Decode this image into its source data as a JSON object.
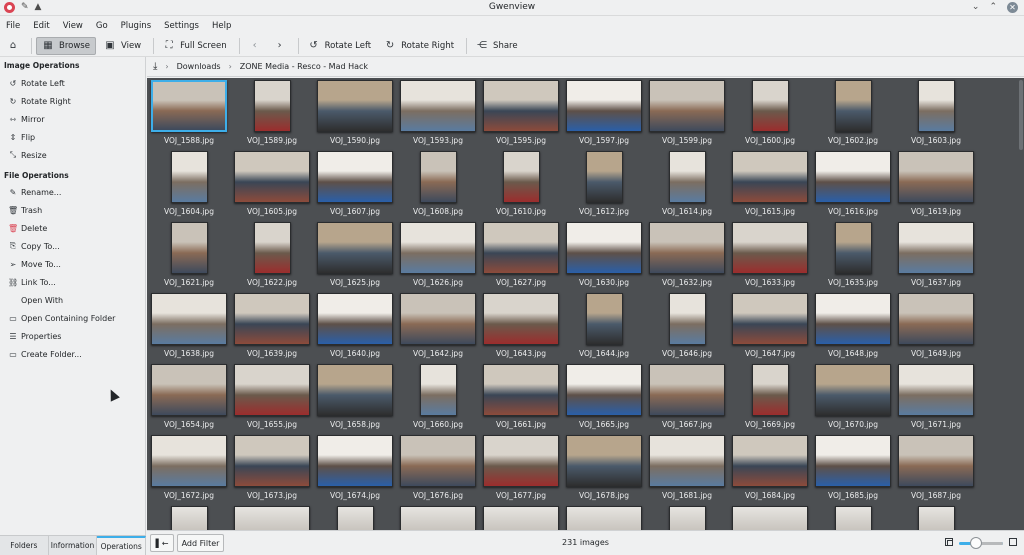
{
  "window": {
    "title": "Gwenview"
  },
  "menu": [
    "File",
    "Edit",
    "View",
    "Go",
    "Plugins",
    "Settings",
    "Help"
  ],
  "toolbar": {
    "browse": "Browse",
    "view": "View",
    "full_screen": "Full Screen",
    "rotate_left": "Rotate Left",
    "rotate_right": "Rotate Right",
    "share": "Share"
  },
  "sidebar": {
    "image_ops_title": "Image Operations",
    "image_ops": [
      {
        "label": "Rotate Left",
        "icon": "rotate-left-icon"
      },
      {
        "label": "Rotate Right",
        "icon": "rotate-right-icon"
      },
      {
        "label": "Mirror",
        "icon": "mirror-icon"
      },
      {
        "label": "Flip",
        "icon": "flip-icon"
      },
      {
        "label": "Resize",
        "icon": "resize-icon"
      }
    ],
    "file_ops_title": "File Operations",
    "file_ops": [
      {
        "label": "Rename...",
        "icon": "rename-icon"
      },
      {
        "label": "Trash",
        "icon": "trash-icon"
      },
      {
        "label": "Delete",
        "icon": "delete-icon"
      },
      {
        "label": "Copy To...",
        "icon": "copy-icon"
      },
      {
        "label": "Move To...",
        "icon": "move-icon"
      },
      {
        "label": "Link To...",
        "icon": "link-icon"
      },
      {
        "label": "Open With",
        "icon": ""
      },
      {
        "label": "Open Containing Folder",
        "icon": "folder-open-icon"
      },
      {
        "label": "Properties",
        "icon": "properties-icon"
      },
      {
        "label": "Create Folder...",
        "icon": "folder-new-icon"
      }
    ],
    "tabs": [
      "Folders",
      "Information",
      "Operations"
    ]
  },
  "breadcrumb": [
    "Downloads",
    "ZONE Media - Resco - Mad Hack"
  ],
  "files": [
    [
      "VOJ_1588.jpg",
      "VOJ_1589.jpg",
      "VOJ_1590.jpg",
      "VOJ_1593.jpg",
      "VOJ_1595.jpg",
      "VOJ_1597.jpg",
      "VOJ_1599.jpg",
      "VOJ_1600.jpg",
      "VOJ_1602.jpg",
      "VOJ_1603.jpg"
    ],
    [
      "VOJ_1604.jpg",
      "VOJ_1605.jpg",
      "VOJ_1607.jpg",
      "VOJ_1608.jpg",
      "VOJ_1610.jpg",
      "VOJ_1612.jpg",
      "VOJ_1614.jpg",
      "VOJ_1615.jpg",
      "VOJ_1616.jpg",
      "VOJ_1619.jpg"
    ],
    [
      "VOJ_1621.jpg",
      "VOJ_1622.jpg",
      "VOJ_1625.jpg",
      "VOJ_1626.jpg",
      "VOJ_1627.jpg",
      "VOJ_1630.jpg",
      "VOJ_1632.jpg",
      "VOJ_1633.jpg",
      "VOJ_1635.jpg",
      "VOJ_1637.jpg"
    ],
    [
      "VOJ_1638.jpg",
      "VOJ_1639.jpg",
      "VOJ_1640.jpg",
      "VOJ_1642.jpg",
      "VOJ_1643.jpg",
      "VOJ_1644.jpg",
      "VOJ_1646.jpg",
      "VOJ_1647.jpg",
      "VOJ_1648.jpg",
      "VOJ_1649.jpg"
    ],
    [
      "VOJ_1654.jpg",
      "VOJ_1655.jpg",
      "VOJ_1658.jpg",
      "VOJ_1660.jpg",
      "VOJ_1661.jpg",
      "VOJ_1665.jpg",
      "VOJ_1667.jpg",
      "VOJ_1669.jpg",
      "VOJ_1670.jpg",
      "VOJ_1671.jpg"
    ],
    [
      "VOJ_1672.jpg",
      "VOJ_1673.jpg",
      "VOJ_1674.jpg",
      "VOJ_1676.jpg",
      "VOJ_1677.jpg",
      "VOJ_1678.jpg",
      "VOJ_1681.jpg",
      "VOJ_1684.jpg",
      "VOJ_1685.jpg",
      "VOJ_1687.jpg"
    ]
  ],
  "status": {
    "add_filter": "Add Filter",
    "count": "231 images"
  },
  "colors": {
    "accent": "#3daee9",
    "grid_bg": "#4c4f52",
    "window_bg": "#eff0f1"
  }
}
